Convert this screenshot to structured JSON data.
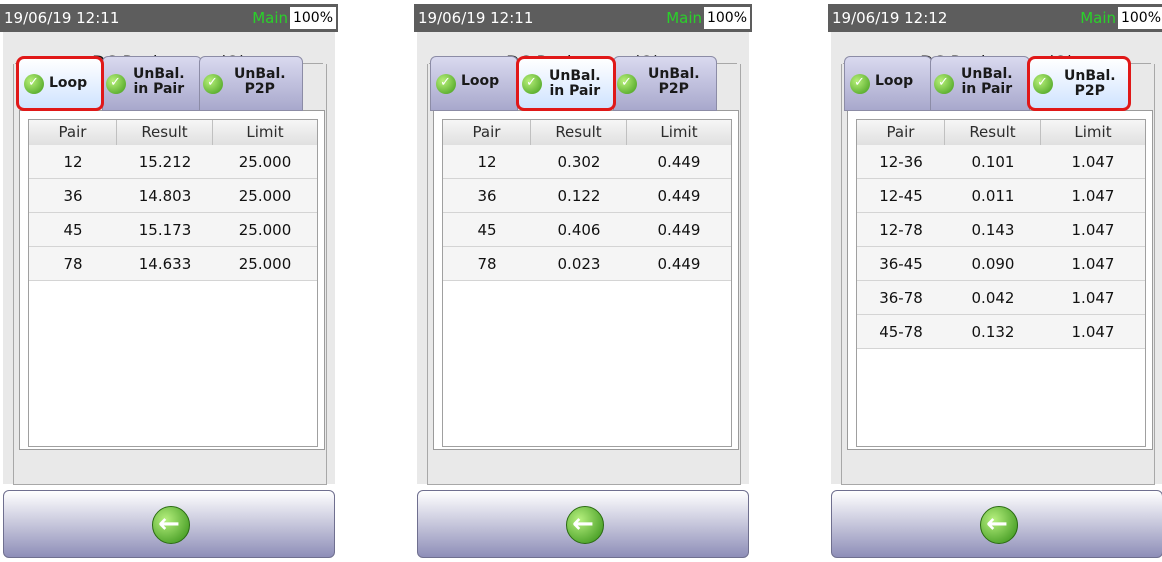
{
  "panels": [
    {
      "time": "19/06/19 12:11",
      "main": "Main",
      "battery": "100%",
      "title": "DC Resistance (Ω)",
      "tabs": [
        "Loop",
        "UnBal.\nin Pair",
        "UnBal.\nP2P"
      ],
      "active_tab": 0,
      "columns": [
        "Pair",
        "Result",
        "Limit"
      ],
      "rows": [
        [
          "12",
          "15.212",
          "25.000"
        ],
        [
          "36",
          "14.803",
          "25.000"
        ],
        [
          "45",
          "15.173",
          "25.000"
        ],
        [
          "78",
          "14.633",
          "25.000"
        ]
      ]
    },
    {
      "time": "19/06/19 12:11",
      "main": "Main",
      "battery": "100%",
      "title": "DC Resistance (Ω)",
      "tabs": [
        "Loop",
        "UnBal.\nin Pair",
        "UnBal.\nP2P"
      ],
      "active_tab": 1,
      "columns": [
        "Pair",
        "Result",
        "Limit"
      ],
      "rows": [
        [
          "12",
          "0.302",
          "0.449"
        ],
        [
          "36",
          "0.122",
          "0.449"
        ],
        [
          "45",
          "0.406",
          "0.449"
        ],
        [
          "78",
          "0.023",
          "0.449"
        ]
      ]
    },
    {
      "time": "19/06/19 12:12",
      "main": "Main",
      "battery": "100%",
      "title": "DC Resistance (Ω)",
      "tabs": [
        "Loop",
        "UnBal.\nin Pair",
        "UnBal.\nP2P"
      ],
      "active_tab": 2,
      "columns": [
        "Pair",
        "Result",
        "Limit"
      ],
      "rows": [
        [
          "12-36",
          "0.101",
          "1.047"
        ],
        [
          "12-45",
          "0.011",
          "1.047"
        ],
        [
          "12-78",
          "0.143",
          "1.047"
        ],
        [
          "36-45",
          "0.090",
          "1.047"
        ],
        [
          "36-78",
          "0.042",
          "1.047"
        ],
        [
          "45-78",
          "0.132",
          "1.047"
        ]
      ]
    }
  ],
  "icons": {
    "check": "check-circle-icon",
    "back": "back-arrow-icon"
  },
  "colors": {
    "status_main": "#2ad12a",
    "active_outline": "#e01818",
    "ok_green": "#3e9a18"
  }
}
